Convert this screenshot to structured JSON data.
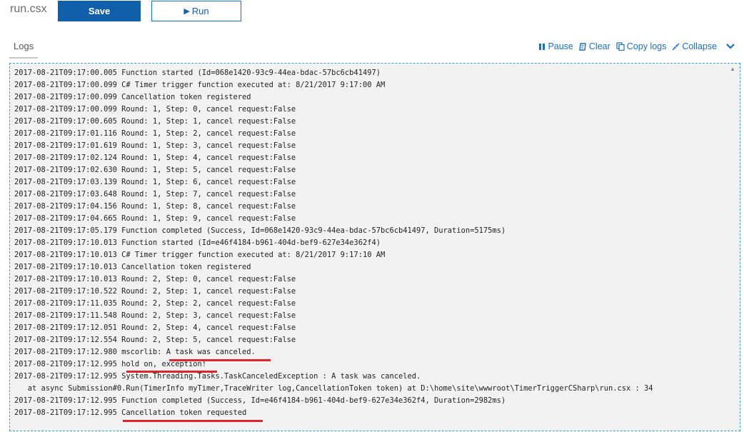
{
  "header": {
    "file_name": "run.csx",
    "save_label": "Save",
    "run_label": "Run"
  },
  "logs": {
    "tab_label": "Logs",
    "toolbar": {
      "pause_label": "Pause",
      "clear_label": "Clear",
      "copy_label": "Copy logs",
      "collapse_label": "Collapse"
    },
    "lines": [
      "2017-08-21T09:17:00.005 Function started (Id=068e1420-93c9-44ea-bdac-57bc6cb41497)",
      "2017-08-21T09:17:00.099 C# Timer trigger function executed at: 8/21/2017 9:17:00 AM",
      "2017-08-21T09:17:00.099 Cancellation token registered",
      "2017-08-21T09:17:00.099 Round: 1, Step: 0, cancel request:False",
      "2017-08-21T09:17:00.605 Round: 1, Step: 1, cancel request:False",
      "2017-08-21T09:17:01.116 Round: 1, Step: 2, cancel request:False",
      "2017-08-21T09:17:01.619 Round: 1, Step: 3, cancel request:False",
      "2017-08-21T09:17:02.124 Round: 1, Step: 4, cancel request:False",
      "2017-08-21T09:17:02.630 Round: 1, Step: 5, cancel request:False",
      "2017-08-21T09:17:03.139 Round: 1, Step: 6, cancel request:False",
      "2017-08-21T09:17:03.648 Round: 1, Step: 7, cancel request:False",
      "2017-08-21T09:17:04.156 Round: 1, Step: 8, cancel request:False",
      "2017-08-21T09:17:04.665 Round: 1, Step: 9, cancel request:False",
      "2017-08-21T09:17:05.179 Function completed (Success, Id=068e1420-93c9-44ea-bdac-57bc6cb41497, Duration=5175ms)",
      "2017-08-21T09:17:10.013 Function started (Id=e46f4184-b961-404d-bef9-627e34e362f4)",
      "2017-08-21T09:17:10.013 C# Timer trigger function executed at: 8/21/2017 9:17:10 AM",
      "2017-08-21T09:17:10.013 Cancellation token registered",
      "2017-08-21T09:17:10.013 Round: 2, Step: 0, cancel request:False",
      "2017-08-21T09:17:10.522 Round: 2, Step: 1, cancel request:False",
      "2017-08-21T09:17:11.035 Round: 2, Step: 2, cancel request:False",
      "2017-08-21T09:17:11.548 Round: 2, Step: 3, cancel request:False",
      "2017-08-21T09:17:12.051 Round: 2, Step: 4, cancel request:False",
      "2017-08-21T09:17:12.554 Round: 2, Step: 5, cancel request:False",
      "2017-08-21T09:17:12.980 mscorlib: A task was canceled.",
      "2017-08-21T09:17:12.995 hold on, exception!",
      "2017-08-21T09:17:12.995 System.Threading.Tasks.TaskCanceledException : A task was canceled.",
      "   at async Submission#0.Run(TimerInfo myTimer,TraceWriter log,CancellationToken token) at D:\\home\\site\\wwwroot\\TimerTriggerCSharp\\run.csx : 34",
      "2017-08-21T09:17:12.995 Function completed (Success, Id=e46f4184-b961-404d-bef9-627e34e362f4, Duration=2982ms)",
      "2017-08-21T09:17:12.995 Cancellation token requested"
    ]
  },
  "colors": {
    "save_bg": "#0f5fab",
    "accent": "#1a6fc6",
    "annotation_red": "#e0242b",
    "panel_bg": "#f2f2f2"
  }
}
